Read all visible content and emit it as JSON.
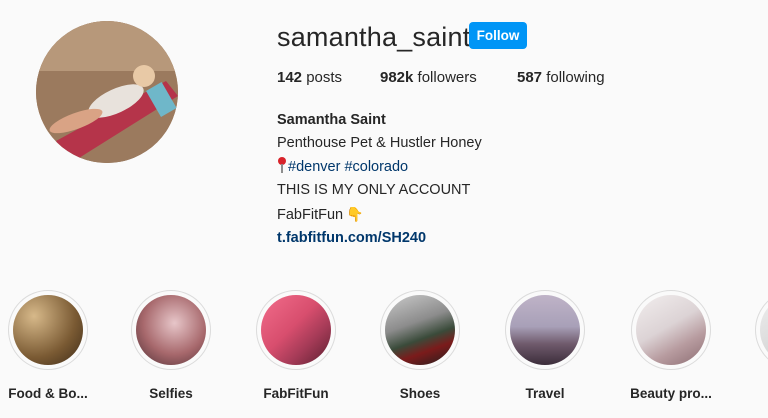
{
  "profile": {
    "username": "samantha_saint",
    "follow_label": "Follow",
    "stats": {
      "posts_count": "142",
      "posts_label": "posts",
      "followers_count": "982k",
      "followers_label": "followers",
      "following_count": "587",
      "following_label": "following"
    },
    "bio": {
      "name": "Samantha Saint",
      "line1": "Penthouse Pet & Hustler Honey",
      "hashtag1": "#denver",
      "hashtag2": "#colorado",
      "line3": "THIS IS MY ONLY ACCOUNT",
      "line4": "FabFitFun",
      "link": "t.fabfitfun.com/SH240"
    }
  },
  "highlights": [
    {
      "label": "Food & Bo..."
    },
    {
      "label": "Selfies"
    },
    {
      "label": "FabFitFun"
    },
    {
      "label": "Shoes"
    },
    {
      "label": "Travel"
    },
    {
      "label": "Beauty pro..."
    },
    {
      "label": ""
    }
  ],
  "colors": {
    "accent": "#0095f6",
    "link": "#00376b",
    "background": "#fafafa",
    "text": "#262626"
  }
}
